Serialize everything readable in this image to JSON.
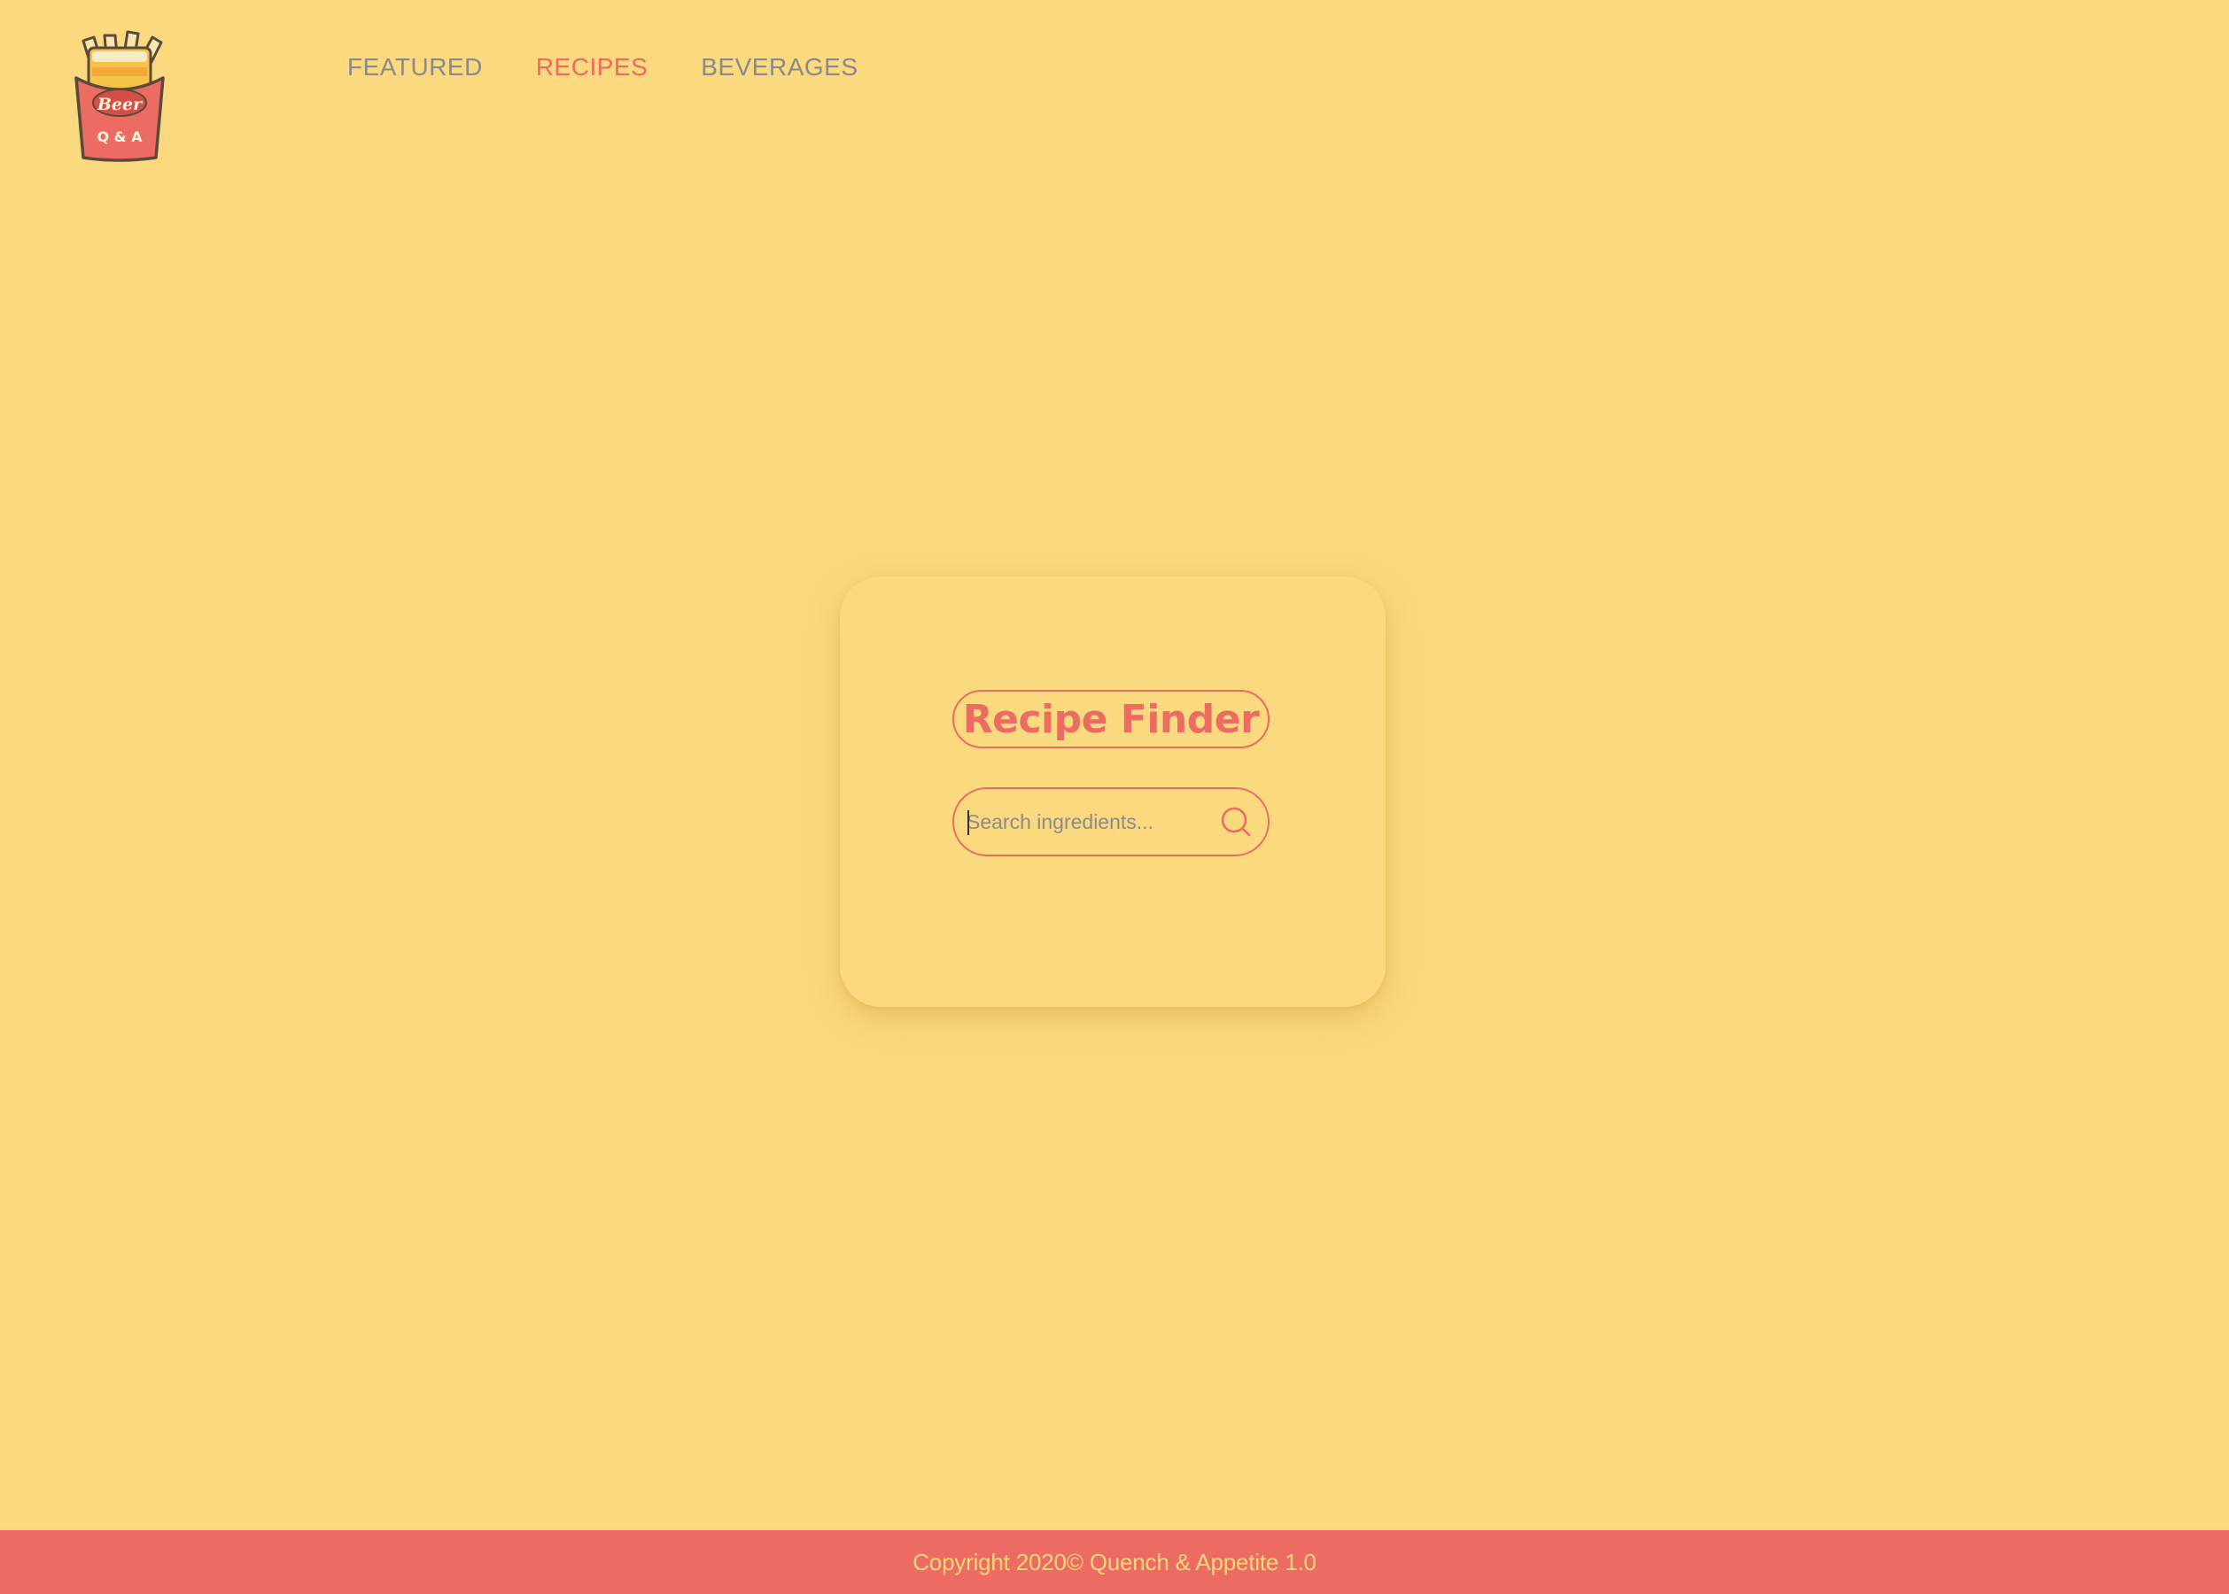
{
  "logo": {
    "top_text": "Beer",
    "bottom_text": "Q & A",
    "colors": {
      "box": "#ec6b63",
      "beer": "#f6c24a",
      "foam": "#f7ecc8",
      "outline": "#5a4a3a"
    }
  },
  "nav": {
    "items": [
      {
        "label": "FEATURED",
        "active": false
      },
      {
        "label": "RECIPES",
        "active": true
      },
      {
        "label": "BEVERAGES",
        "active": false
      }
    ]
  },
  "card": {
    "title": "Recipe Finder",
    "search": {
      "placeholder": "Search ingredients...",
      "value": "",
      "icon": "search-icon"
    }
  },
  "footer": {
    "text": "Copyright 2020© Quench & Appetite 1.0"
  },
  "colors": {
    "background": "#fad97f",
    "accent": "#ec6b63",
    "nav_text": "#8a8a8a",
    "footer_text": "#fbd77a"
  }
}
